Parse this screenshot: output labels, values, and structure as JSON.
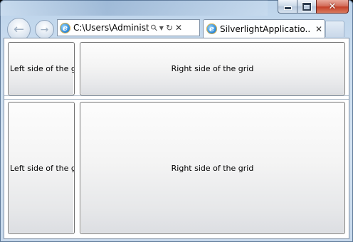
{
  "browser": {
    "address": "C:\\Users\\Administ",
    "tab_title": "SilverlightApplicatio...",
    "icons": {
      "back": "back-arrow-icon",
      "forward": "forward-arrow-icon",
      "page": "ie-page-icon",
      "search": "search-icon",
      "dropdown": "chevron-down-icon",
      "refresh": "refresh-icon",
      "stop": "close-icon"
    },
    "glyphs": {
      "back": "←",
      "forward": "→",
      "ie": "e",
      "search": "⚲",
      "dropdown": "▼",
      "refresh": "↻",
      "stop": "✕",
      "close": "✕",
      "tab_close": "✕"
    }
  },
  "grid": {
    "rows": [
      {
        "left": "Left side of the grid",
        "right": "Right side of the grid"
      },
      {
        "left": "Left side of the grid",
        "right": "Right side of the grid"
      }
    ]
  }
}
